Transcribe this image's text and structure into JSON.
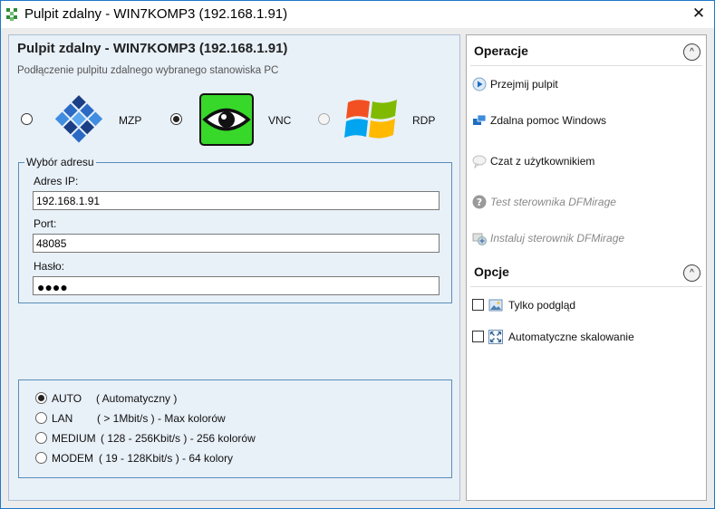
{
  "window": {
    "title": "Pulpit zdalny - WIN7KOMP3 (192.168.1.91)",
    "close_symbol": "✕",
    "app_icon": "checker-icon"
  },
  "left": {
    "title": "Pulpit zdalny - WIN7KOMP3 (192.168.1.91)",
    "subtitle": "Podłączenie pulpitu zdalnego wybranego stanowiska PC",
    "protocols": [
      {
        "label": "MZP",
        "selected": false,
        "enabled": true,
        "icon": "mzp-logo-icon"
      },
      {
        "label": "VNC",
        "selected": true,
        "enabled": true,
        "icon": "vnc-eye-icon"
      },
      {
        "label": "RDP",
        "selected": false,
        "enabled": false,
        "icon": "windows-logo-icon"
      }
    ],
    "address_group": {
      "legend": "Wybór adresu",
      "ip_label": "Adres IP:",
      "ip_value": "192.168.1.91",
      "port_label": "Port:",
      "port_value": "48085",
      "password_label": "Hasło:",
      "password_mask": "●●●●"
    },
    "speeds": [
      {
        "name": "AUTO",
        "desc": "( Automatyczny )",
        "selected": true
      },
      {
        "name": "LAN",
        "desc": "( > 1Mbit/s ) - Max kolorów",
        "selected": false
      },
      {
        "name": "MEDIUM",
        "desc": "( 128 - 256Kbit/s ) - 256 kolorów",
        "selected": false
      },
      {
        "name": "MODEM",
        "desc": "( 19 - 128Kbit/s ) - 64 kolory",
        "selected": false
      }
    ]
  },
  "right": {
    "operations_title": "Operacje",
    "operations_collapse": "^",
    "operations": [
      {
        "label": "Przejmij pulpit",
        "enabled": true,
        "icon": "play-icon"
      },
      {
        "label": "Zdalna pomoc Windows",
        "enabled": true,
        "icon": "remote-help-icon"
      },
      {
        "label": "Czat z użytkownikiem",
        "enabled": true,
        "icon": "chat-bubble-icon"
      },
      {
        "label": "Test sterownika DFMirage",
        "enabled": false,
        "icon": "question-icon"
      },
      {
        "label": "Instaluj sterownik DFMirage",
        "enabled": false,
        "icon": "install-icon"
      }
    ],
    "options_title": "Opcje",
    "options_collapse": "^",
    "options": [
      {
        "label": "Tylko podgląd",
        "checked": false,
        "icon": "preview-picture-icon"
      },
      {
        "label": "Automatyczne skalowanie",
        "checked": false,
        "icon": "expand-arrows-icon"
      }
    ]
  }
}
